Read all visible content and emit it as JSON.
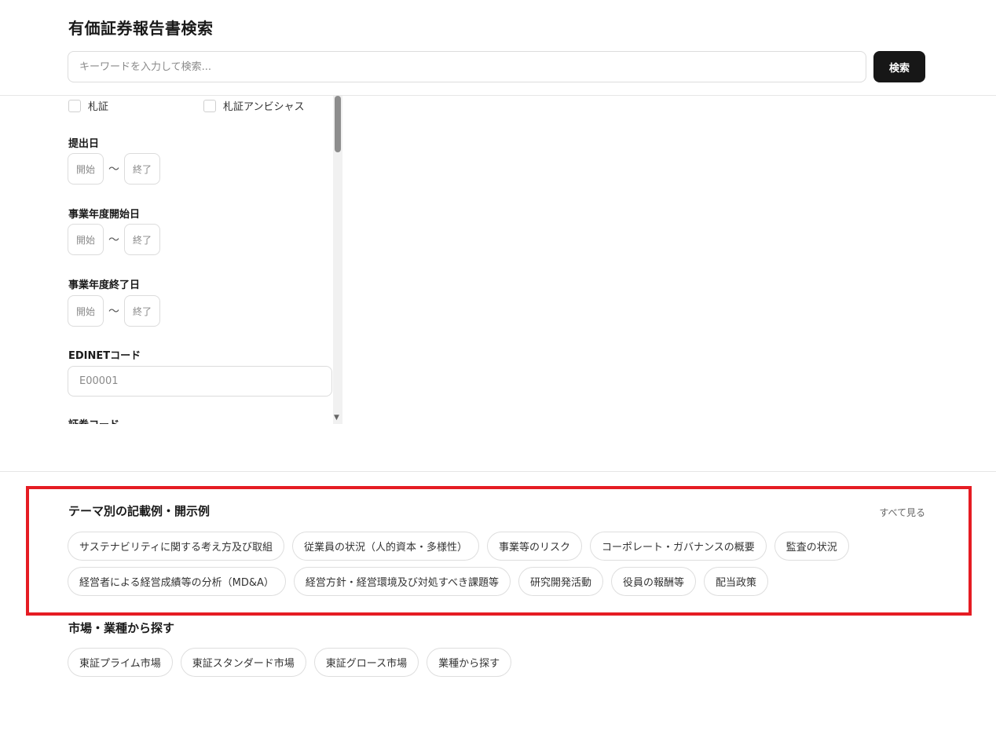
{
  "header": {
    "title": "有価証券報告書検索",
    "search_placeholder": "キーワードを入力して検索...",
    "search_button": "検索"
  },
  "filters": {
    "checkboxes": [
      {
        "label": "札証",
        "checked": false
      },
      {
        "label": "札証アンビシャス",
        "checked": false
      }
    ],
    "submit_date": {
      "label": "提出日",
      "start": "開始",
      "end": "終了",
      "separator": "〜"
    },
    "fiscal_start": {
      "label": "事業年度開始日",
      "start": "開始",
      "end": "終了",
      "separator": "〜"
    },
    "fiscal_end": {
      "label": "事業年度終了日",
      "start": "開始",
      "end": "終了",
      "separator": "〜"
    },
    "edinet": {
      "label": "EDINETコード",
      "placeholder": "E00001"
    },
    "securities_label": "証券コード"
  },
  "themes": {
    "title": "テーマ別の記載例・開示例",
    "see_all": "すべて見る",
    "row1": [
      "サステナビリティに関する考え方及び取組",
      "従業員の状況（人的資本・多様性）",
      "事業等のリスク",
      "コーポレート・ガバナンスの概要",
      "監査の状況"
    ],
    "row2": [
      "経営者による経営成績等の分析（MD&A）",
      "経営方針・経営環境及び対処すべき課題等",
      "研究開発活動",
      "役員の報酬等",
      "配当政策"
    ]
  },
  "market": {
    "title": "市場・業種から探す",
    "chips": [
      "東証プライム市場",
      "東証スタンダード市場",
      "東証グロース市場",
      "業種から探す"
    ]
  },
  "colors": {
    "accent": "#171717",
    "highlight": "#e51c23",
    "border": "#dedede"
  }
}
